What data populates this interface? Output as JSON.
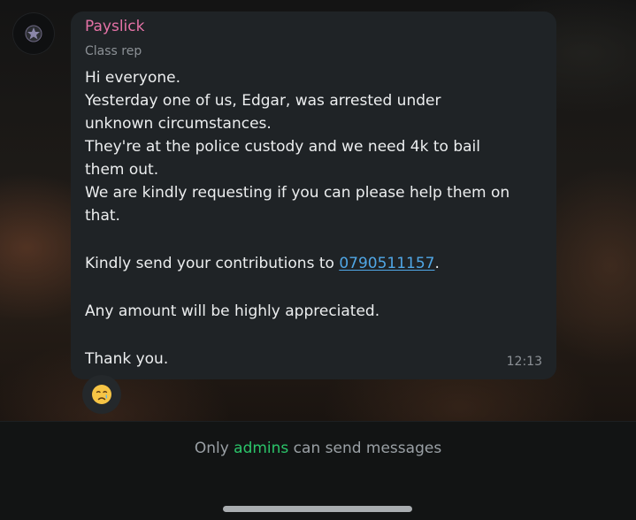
{
  "chat": {
    "message": {
      "sender": "Payslick",
      "role": "Class rep",
      "avatar_icon": "dark-emblem-avatar",
      "lines": [
        "Hi everyone.",
        "Yesterday one of us, Edgar, was arrested under",
        "unknown circumstances.",
        "They're at the police custody and we need 4k to bail",
        "them out.",
        "We are kindly requesting if you can please help them on",
        "that."
      ],
      "contribution_prefix": "Kindly send your contributions to ",
      "phone": "0790511157",
      "contribution_suffix": ".",
      "appreciation": "Any amount will be highly appreciated.",
      "closing": "Thank you.",
      "time": "12:13"
    },
    "reaction": {
      "emoji_name": "crying-face-emoji"
    }
  },
  "footer": {
    "notice_prefix": "Only ",
    "notice_highlight": "admins",
    "notice_suffix": " can send messages"
  },
  "colors": {
    "sender_name": "#e472a6",
    "link": "#50a7e6",
    "admins_highlight": "#2bc56a",
    "bubble": "#1f2326"
  }
}
